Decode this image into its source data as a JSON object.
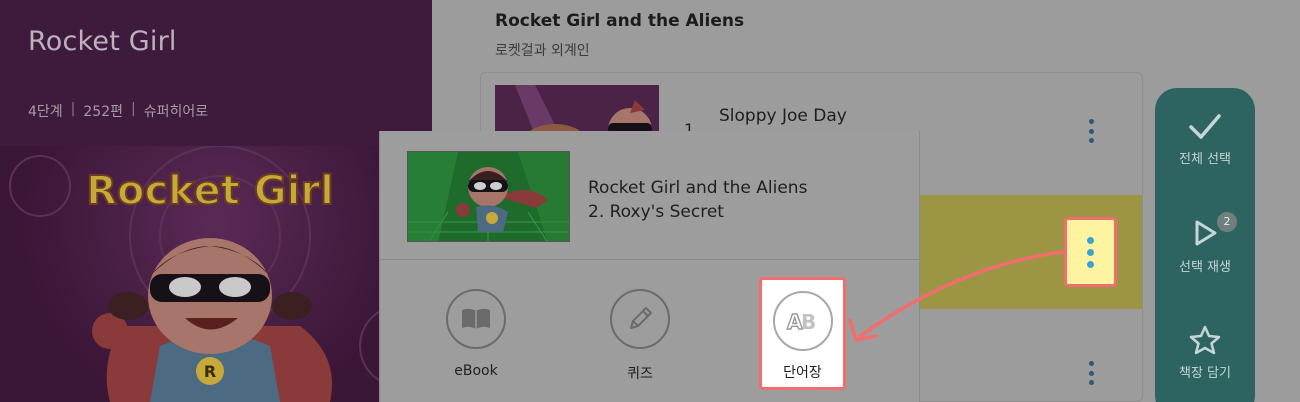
{
  "series": {
    "title": "Rocket Girl",
    "level": "4단계",
    "count": "252편",
    "genre": "슈퍼히어로",
    "separator": "|",
    "logo_text": "Rocket Girl"
  },
  "book": {
    "title": "Rocket Girl and the Aliens",
    "subtitle": "로켓걸과 외계인"
  },
  "episodes": [
    {
      "number": "1",
      "title": "Sloppy Joe Day"
    }
  ],
  "actions": [
    {
      "label": "전체 선택",
      "icon": "check-icon"
    },
    {
      "label": "선택 재생",
      "icon": "play-icon",
      "badge": "2"
    },
    {
      "label": "책장 담기",
      "icon": "star-icon"
    }
  ],
  "modal": {
    "line1": "Rocket Girl and the Aliens",
    "line2": "2. Roxy's Secret",
    "options": [
      {
        "label": "eBook",
        "icon": "book-icon"
      },
      {
        "label": "퀴즈",
        "icon": "pencil-icon"
      },
      {
        "label": "단어장",
        "icon": "vocabulary-icon",
        "highlighted": true
      }
    ]
  },
  "colors": {
    "highlight_border": "#f26d6d",
    "highlight_fill": "#fef3a0",
    "action_bar": "#2d6462",
    "kebab_dot": "#3aa3cf"
  }
}
